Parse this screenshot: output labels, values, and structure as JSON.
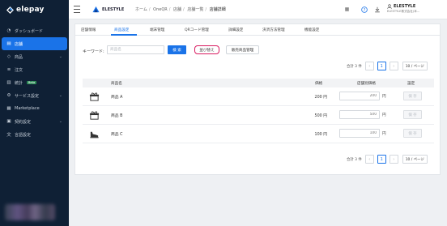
{
  "app": {
    "logo_text": "elepay"
  },
  "sidebar": {
    "items": [
      {
        "label": "ダッシュボード",
        "icon": "dashboard-icon"
      },
      {
        "label": "店舗",
        "icon": "store-icon",
        "active": true
      },
      {
        "label": "商品",
        "icon": "tag-icon",
        "expandable": true
      },
      {
        "label": "注文",
        "icon": "list-icon"
      },
      {
        "label": "統計",
        "icon": "chart-icon",
        "badge": "Beta"
      },
      {
        "label": "サービス設定",
        "icon": "gear-icon",
        "expandable": true
      },
      {
        "label": "Marketplace",
        "icon": "grid-icon"
      },
      {
        "label": "契約設定",
        "icon": "contract-icon",
        "expandable": true
      },
      {
        "label": "言語設定",
        "icon": "language-icon"
      }
    ]
  },
  "header": {
    "brand": "ELESTYLE",
    "breadcrumbs": [
      "ホーム",
      "OneQR",
      "店舗",
      "店舗一覧",
      "店舗詳細"
    ],
    "user_name": "ELESTYLE",
    "user_sub": "ELESTYLE株式会社(本..."
  },
  "tabs": [
    "店舗情報",
    "商品設定",
    "端末管理",
    "QRコード管理",
    "詳細設定",
    "決済方法管理",
    "機能設定"
  ],
  "active_tab": "商品設定",
  "search": {
    "label": "キーワード:",
    "placeholder": "商品名",
    "search_button": "検 索",
    "sort_button": "並び替え",
    "sale_button": "販売商品管理"
  },
  "pager": {
    "total": "合計 3 件",
    "prev": "‹",
    "current_page": "1",
    "next": "›",
    "page_size": "10 / ページ"
  },
  "table": {
    "headers": {
      "name": "商品名",
      "price": "価格",
      "shop_price": "店舗別価格",
      "setting": "設定"
    },
    "rows": [
      {
        "name": "商品 A",
        "price": "200 円",
        "shop_placeholder": "200",
        "unit": "円",
        "action": "保 存",
        "icon": "gift-box-icon"
      },
      {
        "name": "商品 B",
        "price": "500 円",
        "shop_placeholder": "500",
        "unit": "円",
        "action": "保 存",
        "icon": "gift-box-icon"
      },
      {
        "name": "商品 C",
        "price": "100 円",
        "shop_placeholder": "100",
        "unit": "円",
        "action": "保 存",
        "icon": "shoe-icon"
      }
    ]
  },
  "colors": {
    "sidebar_bg": "#0f2035",
    "accent": "#1a73e8",
    "highlight": "#d81b60"
  }
}
